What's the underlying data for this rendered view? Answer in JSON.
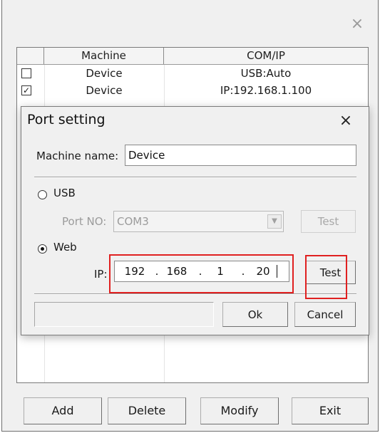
{
  "outer_window": {
    "close_glyph": "×",
    "columns": [
      "Machine",
      "COM/IP"
    ],
    "rows": [
      {
        "checked": false,
        "machine": "Device",
        "address": "USB:Auto"
      },
      {
        "checked": true,
        "machine": "Device",
        "address": "IP:192.168.1.100"
      }
    ],
    "buttons": {
      "add": "Add",
      "delete": "Delete",
      "modify": "Modify",
      "exit": "Exit"
    }
  },
  "port_dialog": {
    "title": "Port setting",
    "close_glyph": "×",
    "machine_name_label": "Machine name:",
    "machine_name_value": "Device",
    "usb_label": "USB",
    "usb_selected": false,
    "port_no_label": "Port NO:",
    "port_no_value": "COM3",
    "usb_test_label": "Test",
    "web_label": "Web",
    "web_selected": true,
    "ip_label": "IP:",
    "ip_octets": [
      "192",
      "168",
      "1",
      "20"
    ],
    "web_test_label": "Test",
    "status_text": "",
    "ok_label": "Ok",
    "cancel_label": "Cancel"
  },
  "colors": {
    "highlight": "#e02020",
    "window_bg": "#f0f0f0"
  },
  "icons": {
    "check_mark": "✓",
    "dropdown_arrow": "▼"
  }
}
